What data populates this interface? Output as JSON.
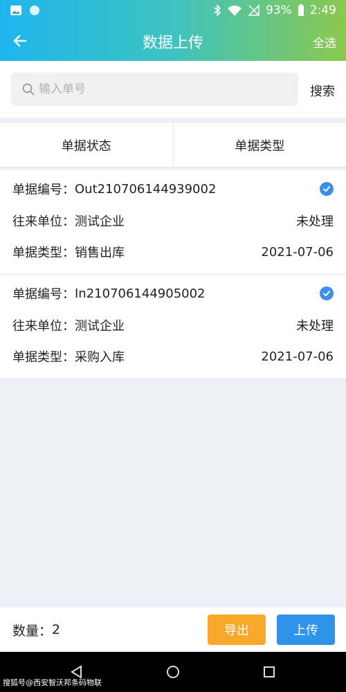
{
  "status_bar": {
    "battery": "93%",
    "time": "2:49"
  },
  "header": {
    "title": "数据上传",
    "select_all": "全选"
  },
  "search": {
    "placeholder": "输入单号",
    "button": "搜索"
  },
  "filters": [
    "单据状态",
    "单据类型"
  ],
  "records": [
    {
      "number_label": "单据编号：",
      "number": "Out210706144939002",
      "partner_label": "往来单位：",
      "partner": "测试企业",
      "status": "未处理",
      "type_label": "单据类型：",
      "type": "销售出库",
      "date": "2021-07-06"
    },
    {
      "number_label": "单据编号：",
      "number": "In210706144905002",
      "partner_label": "往来单位：",
      "partner": "测试企业",
      "status": "未处理",
      "type_label": "单据类型：",
      "type": "采购入库",
      "date": "2021-07-06"
    }
  ],
  "footer": {
    "count_label": "数量：",
    "count": "2",
    "export": "导出",
    "upload": "上传"
  },
  "watermark": "搜狐号@西安智沃邦条码物联",
  "colors": {
    "header_start": "#1fb6ef",
    "header_end": "#8cc84e",
    "export": "#f8a929",
    "upload": "#2f93e9",
    "check": "#3b8fe8"
  }
}
